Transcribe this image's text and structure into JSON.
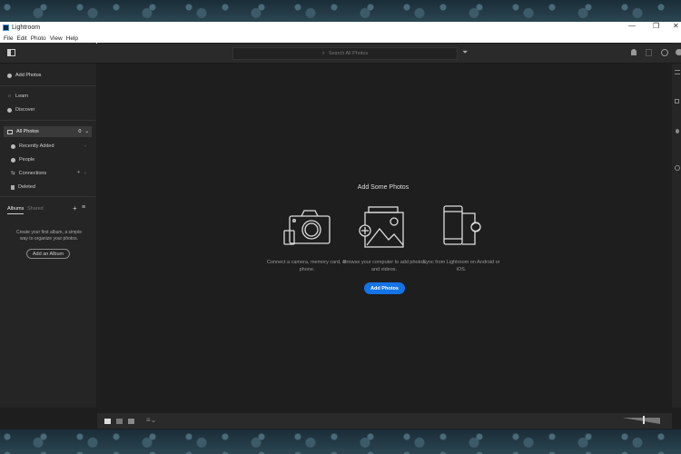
{
  "window": {
    "title": "Lightroom",
    "minimize": "—",
    "maximize": "❐",
    "close": "✕"
  },
  "menu": [
    "File",
    "Edit",
    "Photo",
    "View",
    "Help"
  ],
  "search": {
    "placeholder": "Search All Photos"
  },
  "sidebar": {
    "add_photos": "Add Photos",
    "learn": "Learn",
    "discover": "Discover",
    "all_photos": "All Photos",
    "all_photos_count": "0",
    "items": [
      {
        "label": "Recently Added"
      },
      {
        "label": "People"
      },
      {
        "label": "Connections"
      },
      {
        "label": "Deleted"
      }
    ],
    "tabs": [
      "Albums",
      "Shared"
    ],
    "empty_text": "Create your first album, a simple way to organize your photos.",
    "add_album": "Add an Album"
  },
  "main": {
    "heading": "Add Some Photos",
    "options": [
      {
        "text": "Connect a camera, memory card, or phone."
      },
      {
        "text": "Browse your computer to add photos and videos."
      },
      {
        "text": "Sync from Lightroom on Android or iOS."
      }
    ],
    "button": "Add Photos"
  },
  "colors": {
    "accent": "#1473e6"
  }
}
